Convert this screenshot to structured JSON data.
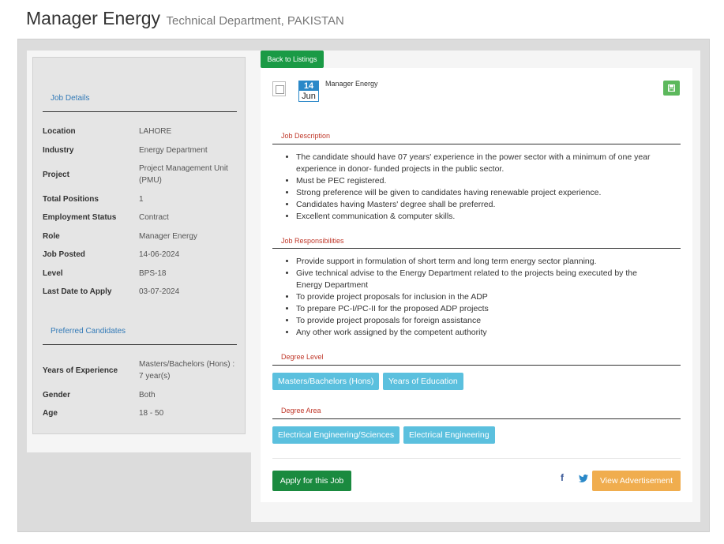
{
  "header": {
    "title": "Manager Energy",
    "subtitle": "Technical Department, PAKISTAN"
  },
  "left": {
    "job_details_heading": "Job Details",
    "details": [
      {
        "label": "Location",
        "value": "LAHORE"
      },
      {
        "label": "Industry",
        "value": "Energy Department"
      },
      {
        "label": "Project",
        "value": "Project Management Unit (PMU)"
      },
      {
        "label": "Total Positions",
        "value": "1"
      },
      {
        "label": "Employment Status",
        "value": "Contract"
      },
      {
        "label": "Role",
        "value": "Manager Energy"
      },
      {
        "label": "Job Posted",
        "value": "14-06-2024"
      },
      {
        "label": "Level",
        "value": "BPS-18"
      },
      {
        "label": "Last Date to Apply",
        "value": "03-07-2024"
      }
    ],
    "preferred_heading": "Preferred Candidates",
    "preferred": [
      {
        "label": "Years of Experience",
        "value": "Masters/Bachelors (Hons) : 7 year(s)"
      },
      {
        "label": "Gender",
        "value": "Both"
      },
      {
        "label": "Age",
        "value": "18 - 50"
      }
    ]
  },
  "right": {
    "back_label": "Back to Listings",
    "date_day": "14",
    "date_month": "Jun",
    "job_title": "Manager Energy",
    "save_icon": "floppy-disk-icon",
    "description_heading": "Job Description",
    "description": [
      "The candidate should have 07 years' experience in the power sector with a minimum of one year experience in donor- funded projects in the public sector.",
      "Must be PEC registered.",
      "Strong preference will be given to candidates having renewable project experience.",
      "Candidates having Masters' degree shall be preferred.",
      "Excellent communication & computer skills."
    ],
    "responsibilities_heading": "Job Responsibilities",
    "responsibilities": [
      "Provide support in formulation of short term and long term energy sector planning.",
      "Give technical advise to the Energy Department related to the projects being executed by the Energy Department",
      "To provide project proposals for inclusion in the ADP",
      "To prepare PC-I/PC-II for the proposed ADP projects",
      "To provide project proposals for foreign assistance",
      "Any other work assigned by the competent authority"
    ],
    "degree_level_heading": "Degree Level",
    "degree_levels": [
      "Masters/Bachelors (Hons)",
      "Years of Education"
    ],
    "degree_area_heading": "Degree Area",
    "degree_areas": [
      "Electrical Engineering/Sciences",
      "Electrical Engineering"
    ],
    "apply_label": "Apply for this Job",
    "facebook_glyph": "f",
    "view_ad_label": "View Advertisement"
  },
  "colors": {
    "green": "#1a9a45",
    "tag_blue": "#5bc0de",
    "orange": "#f0ad4e",
    "heading_red": "#c0392b",
    "link_blue": "#337ab7"
  }
}
